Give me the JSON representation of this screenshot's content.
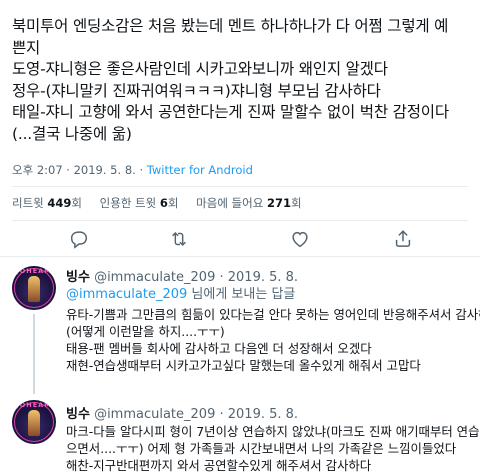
{
  "tweet": {
    "lines": [
      "북미투어 엔딩소감은 처음 봤는데 멘트 하나하나가 다 어쩜 그렇게 예",
      "쁜지",
      "도영-쟈니형은 좋은사람인데 시카고와보니까 왜인지 알겠다",
      "정우-(쟈니말키 진짜귀여워ㅋㅋㅋ)쟈니형 부모님 감사하다",
      "태일-쟈니 고향에 와서 공연한다는게 진짜 말할수 없이 벅찬 감정이다",
      "(...결국 나중에 욺)"
    ],
    "time": "오후 2:07",
    "date": "2019. 5. 8.",
    "client": "Twitter for Android",
    "retweets_label": "리트윗",
    "retweets": "449",
    "retweets_unit": "회",
    "quotes_label": "인용한 트윗",
    "quotes": "6",
    "quotes_unit": "회",
    "likes_label": "마음에 들어요",
    "likes": "271",
    "likes_unit": "회"
  },
  "actions": {
    "icons": [
      "reply-icon",
      "retweet-icon",
      "like-icon",
      "share-icon"
    ]
  },
  "replies": [
    {
      "name": "빙수",
      "handle": "@immaculate_209",
      "date": "2019. 5. 8.",
      "replying_to_mention": "@immaculate_209",
      "replying_to_suffix": " 님에게 보내는 답글",
      "lines": [
        "유타-기쁨과 그만큼의 힘듦이 있다는걸 안다 못하는 영어인데 반응해주셔서 감사하다",
        "(어떻게 이런말을 하지....ㅜㅜ)",
        "태용-팬 멤버들 회사에 감사하고 다음엔 더 성장해서 오겠다",
        "재현-연습생때부터 시카고가고싶다 말했는데 올수있게 해줘서 고맙다"
      ],
      "avatar_text": "JOHEAM"
    },
    {
      "name": "빙수",
      "handle": "@immaculate_209",
      "date": "2019. 5. 8.",
      "lines": [
        "마크-다들 알다시피 형이 7년이상 연습하지 않았냐(마크도 진짜 애기때부터 연습했",
        "으면서....ㅜㅜ) 어제 형 가족들과 시간보내면서 나의 가족같은 느낌이들었다",
        "해찬-지구반대편까지 와서 공연할수있게 해주셔서 감사하다"
      ],
      "avatar_text": "JOHEAM"
    }
  ],
  "colors": {
    "link": "#1d9bf0",
    "secondary_text": "#536471",
    "divider": "#e6ecf0"
  }
}
